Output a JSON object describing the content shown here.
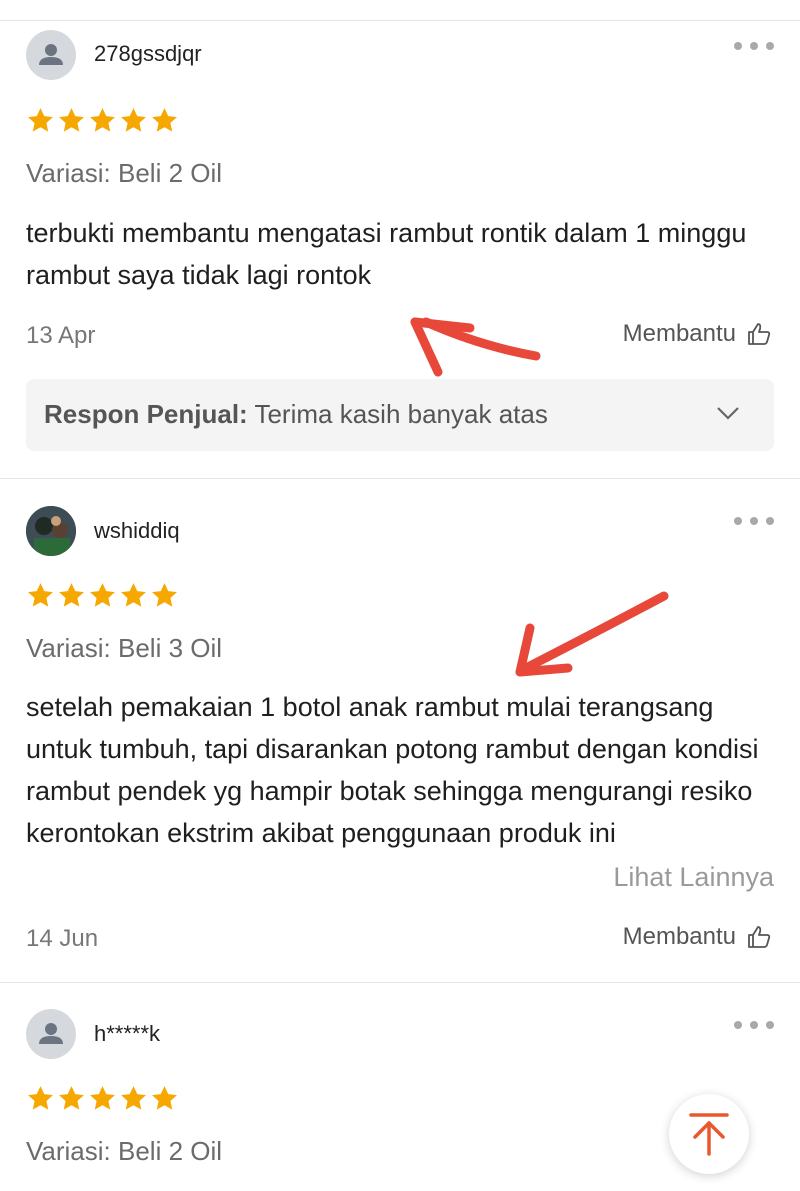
{
  "reviews": [
    {
      "username": "278gssdjqr",
      "rating": 5,
      "variation": "Variasi: Beli 2 Oil",
      "comment": "terbukti membantu mengatasi rambut rontik dalam 1 minggu rambut saya tidak lagi rontok",
      "date": "13 Apr",
      "helpful_label": "Membantu",
      "seller_response": {
        "label": "Respon Penjual:",
        "text": "Terima kasih banyak atas"
      }
    },
    {
      "username": "wshiddiq",
      "rating": 5,
      "variation": "Variasi: Beli 3 Oil",
      "comment": "setelah pemakaian 1 botol anak rambut mulai terangsang untuk tumbuh, tapi disarankan potong rambut dengan kondisi rambut pendek yg hampir botak sehingga mengurangi resiko kerontokan ekstrim akibat penggunaan produk ini",
      "see_more_label": "Lihat Lainnya",
      "date": "14 Jun",
      "helpful_label": "Membantu"
    },
    {
      "username": "h*****k",
      "rating": 5,
      "variation": "Variasi: Beli 2 Oil"
    }
  ],
  "colors": {
    "star": "#f6a800",
    "annotation_arrow": "#e8483a",
    "scroll_top_icon": "#e8582c"
  },
  "icons": {
    "more": "more-dots-icon",
    "helpful": "thumbs-up-icon",
    "expand": "chevron-down-icon",
    "scroll_top": "arrow-up-icon"
  }
}
